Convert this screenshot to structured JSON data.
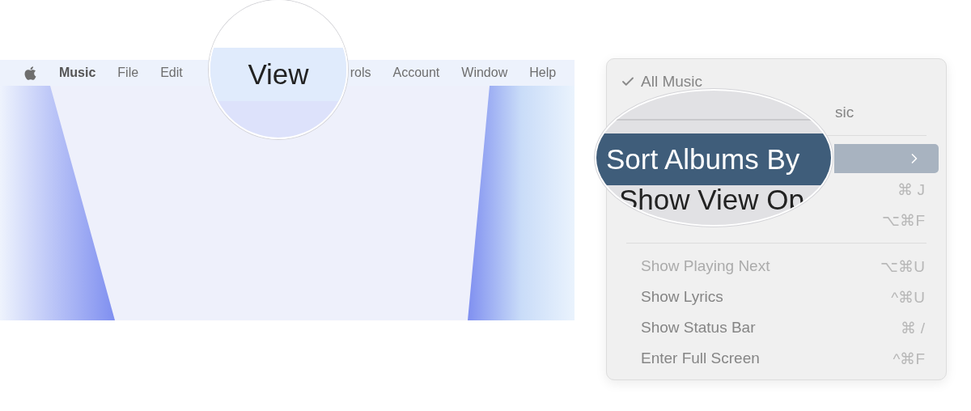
{
  "menu_bar": {
    "items": [
      {
        "label": "Music",
        "kind": "app"
      },
      {
        "label": "File",
        "kind": "menu"
      },
      {
        "label": "Edit",
        "kind": "menu"
      },
      {
        "label": "rols",
        "kind": "partial"
      },
      {
        "label": "Account",
        "kind": "menu"
      },
      {
        "label": "Window",
        "kind": "menu"
      },
      {
        "label": "Help",
        "kind": "menu"
      }
    ]
  },
  "menu_magnifier": {
    "label": "View"
  },
  "view_menu": {
    "items": [
      {
        "kind": "check",
        "label": "All Music",
        "checked": true,
        "selected": false
      },
      {
        "kind": "covered",
        "label": "sic",
        "selected": false
      },
      {
        "kind": "separator"
      },
      {
        "kind": "submenu",
        "selected": true
      },
      {
        "kind": "covered",
        "shortcut": "⌘ J",
        "selected": false
      },
      {
        "kind": "covered",
        "shortcut": "⌥⌘F",
        "selected": false
      },
      {
        "kind": "separator"
      },
      {
        "kind": "item",
        "label": "Show Playing Next",
        "shortcut": "⌥⌘U",
        "disabled": true,
        "selected": false
      },
      {
        "kind": "item",
        "label": "Show Lyrics",
        "shortcut": "^⌘U",
        "disabled": false,
        "selected": false
      },
      {
        "kind": "item",
        "label": "Show Status Bar",
        "shortcut": "⌘ /",
        "disabled": false,
        "selected": false
      },
      {
        "kind": "item",
        "label": "Enter Full Screen",
        "shortcut": "^⌘F",
        "disabled": false,
        "selected": false
      }
    ]
  },
  "submenu_magnifier": {
    "highlighted": "Sort Albums By",
    "below": "Show View Op"
  }
}
